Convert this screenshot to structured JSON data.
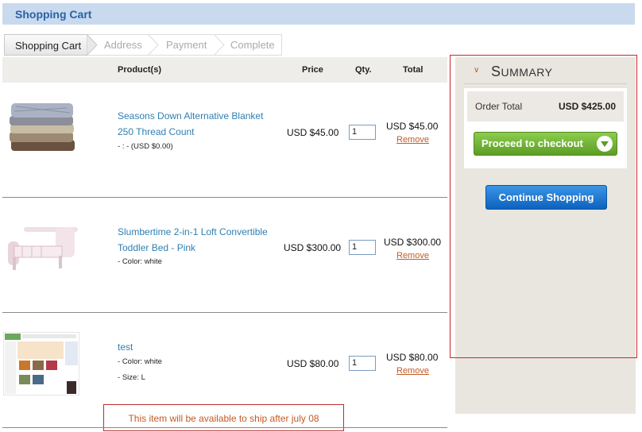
{
  "page_title": "Shopping Cart",
  "steps": [
    "Shopping Cart",
    "Address",
    "Payment",
    "Complete"
  ],
  "columns": {
    "product": "Product(s)",
    "price": "Price",
    "qty": "Qty.",
    "total": "Total"
  },
  "items": [
    {
      "name_line1": "Seasons Down Alternative Blanket",
      "name_line2": "250 Thread Count",
      "options": [
        ": - (USD $0.00)"
      ],
      "price": "USD $45.00",
      "qty": "1",
      "total": "USD $45.00",
      "remove": "Remove",
      "image": "folded-blankets-image"
    },
    {
      "name_line1": "Slumbertime 2-in-1 Loft Convertible",
      "name_line2": "Toddler Bed - Pink",
      "options": [
        "Color: white"
      ],
      "price": "USD $300.00",
      "qty": "1",
      "total": "USD $300.00",
      "remove": "Remove",
      "image": "toddler-bed-image"
    },
    {
      "name_line1": "test",
      "name_line2": "",
      "options": [
        "Color: white",
        "Size: L"
      ],
      "price": "USD $80.00",
      "qty": "1",
      "total": "USD $80.00",
      "remove": "Remove",
      "image": "website-screenshot-image"
    }
  ],
  "notice": "This item will be available to ship after july 08",
  "summary": {
    "title_first": "S",
    "title_rest": "UMMARY",
    "order_total_label": "Order Total",
    "order_total_value": "USD $425.00",
    "checkout_label": "Proceed to checkout",
    "continue_label": "Continue Shopping"
  },
  "colors": {
    "title_bar": "#c9daee",
    "link": "#2f7fb3",
    "remove": "#c35a26",
    "checkout_green": "#6aaa2f",
    "continue_blue": "#1776d2",
    "highlight_border": "#c8282a"
  }
}
